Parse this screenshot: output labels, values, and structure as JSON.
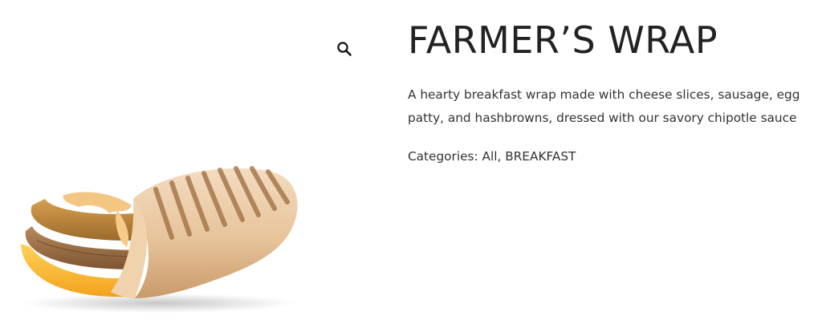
{
  "product": {
    "title": "FARMER’S WRAP",
    "description": "A hearty breakfast wrap made with cheese slices, sausage, egg patty, and hashbrowns, dressed with our savory chipotle sauce",
    "categories_label": "Categories:",
    "categories": [
      "All",
      "BREAKFAST"
    ],
    "category_separator": ", "
  },
  "gallery": {
    "zoom_icon": "search-icon",
    "image_subject": "breakfast-wrap"
  },
  "colors": {
    "text": "#222222",
    "body_text": "#333333",
    "background": "#ffffff"
  }
}
